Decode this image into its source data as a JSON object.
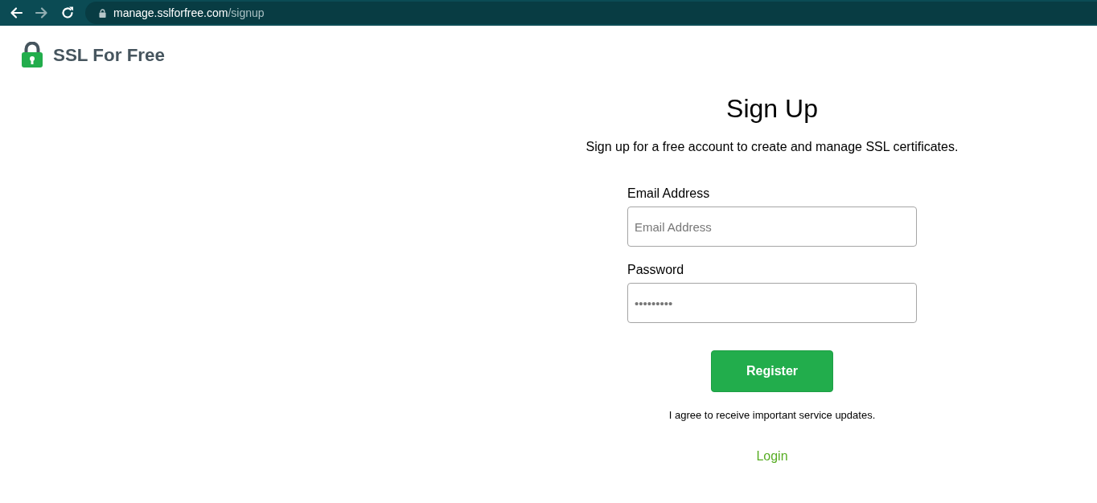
{
  "browser": {
    "nav_buttons": [
      {
        "kind": "back",
        "disabled": false
      },
      {
        "kind": "forward",
        "disabled": true
      },
      {
        "kind": "reload",
        "disabled": false
      }
    ],
    "url": {
      "host": "manage.sslforfree.com",
      "path": "/signup"
    }
  },
  "header": {
    "logo_text": "SSL For Free"
  },
  "signup": {
    "title": "Sign Up",
    "subtitle": "Sign up for a free account to create and manage SSL certificates.",
    "fields": [
      {
        "label": "Email Address",
        "placeholder": "Email Address"
      },
      {
        "label": "Password",
        "placeholder": "•••••••••"
      }
    ],
    "submit": "Register",
    "note": "I agree to receive important service updates.",
    "login_link": "Login"
  }
}
